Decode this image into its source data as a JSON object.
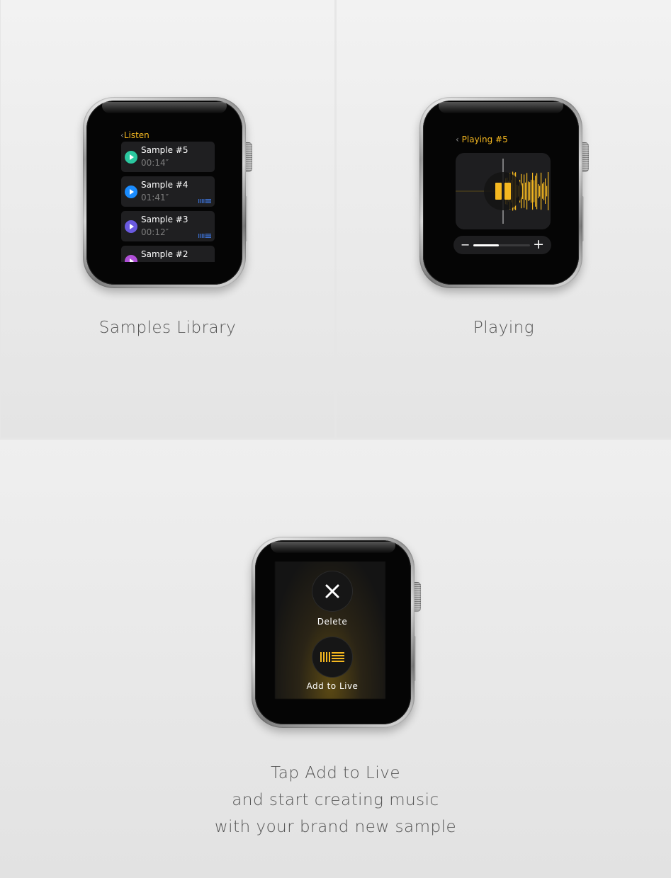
{
  "panels": {
    "samples_library": {
      "caption": "Samples Library",
      "nav_title": "Listen",
      "samples": [
        {
          "name": "Sample #5",
          "time": "00:14″",
          "color": "#2bc8a0",
          "live": false
        },
        {
          "name": "Sample #4",
          "time": "01:41″",
          "color": "#1a8cff",
          "live": true
        },
        {
          "name": "Sample #3",
          "time": "00:12″",
          "color": "#6a5ae0",
          "live": true
        },
        {
          "name": "Sample #2",
          "time": "",
          "color": "#b04fd8",
          "live": false
        }
      ]
    },
    "playing": {
      "caption": "Playing",
      "nav_title": "Playing #5",
      "volume_minus": "−",
      "volume_plus": "+",
      "volume_level": 0.45
    },
    "add_to_live": {
      "caption_lines": [
        "Tap Add to Live",
        "and start creating music",
        "with your brand new sample"
      ],
      "delete_label": "Delete",
      "add_label": "Add to Live"
    }
  },
  "icons": {
    "back": "chevron-left-icon",
    "play": "play-icon",
    "pause": "pause-icon",
    "close": "close-icon",
    "live": "ableton-live-icon"
  },
  "colors": {
    "accent": "#f5b820",
    "screen": "#050505",
    "row": "#1f1f21"
  }
}
